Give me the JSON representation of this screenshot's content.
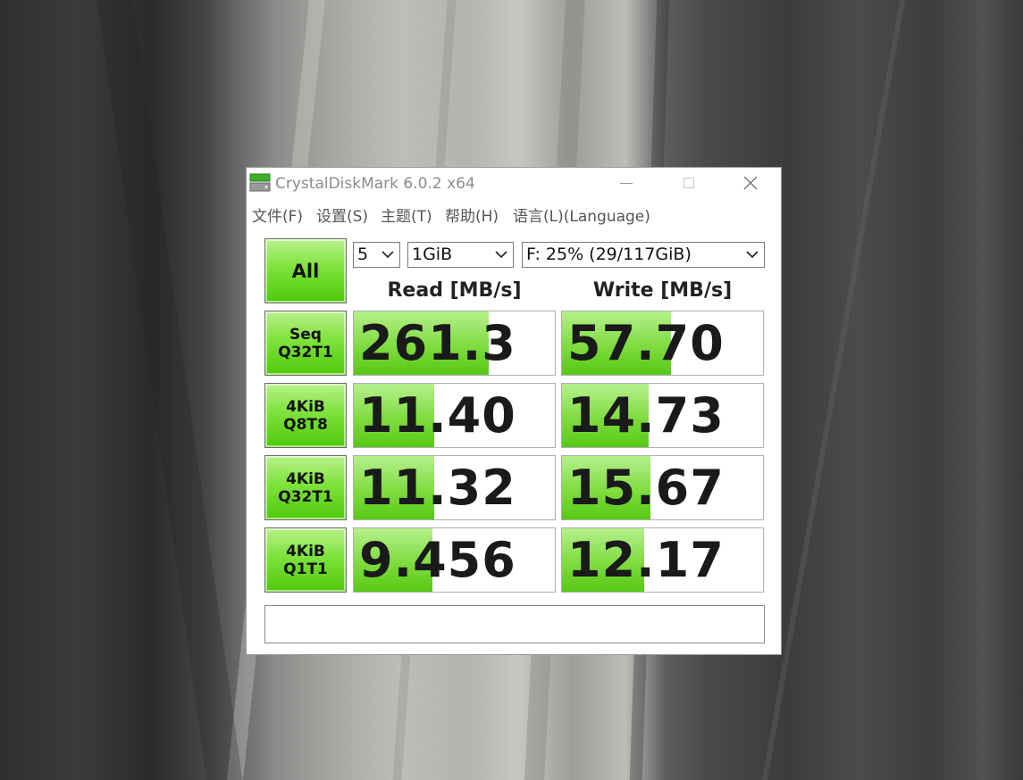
{
  "window": {
    "title": "CrystalDiskMark 6.0.2 x64",
    "menu": [
      "文件(F)",
      "设置(S)",
      "主题(T)",
      "帮助(H)",
      "语言(L)(Language)"
    ]
  },
  "controls": {
    "all_label": "All",
    "test_count": "5",
    "test_size": "1GiB",
    "drive": "F: 25% (29/117GiB)"
  },
  "headers": {
    "read": "Read [MB/s]",
    "write": "Write [MB/s]"
  },
  "rows": [
    {
      "line1": "Seq",
      "line2": "Q32T1",
      "read": "261.3",
      "write": "57.70",
      "read_fill": 0.67,
      "write_fill": 0.54
    },
    {
      "line1": "4KiB",
      "line2": "Q8T8",
      "read": "11.40",
      "write": "14.73",
      "read_fill": 0.4,
      "write_fill": 0.43
    },
    {
      "line1": "4KiB",
      "line2": "Q32T1",
      "read": "11.32",
      "write": "15.67",
      "read_fill": 0.4,
      "write_fill": 0.44
    },
    {
      "line1": "4KiB",
      "line2": "Q1T1",
      "read": "9.456",
      "write": "12.17",
      "read_fill": 0.39,
      "write_fill": 0.41
    }
  ],
  "comment": "",
  "colors": {
    "accent_green": "#57c914",
    "window_bg": "#ffffff"
  },
  "icons": {
    "app": "disk-icon",
    "minimize": "minimize-icon",
    "maximize": "maximize-icon",
    "close": "close-icon"
  }
}
